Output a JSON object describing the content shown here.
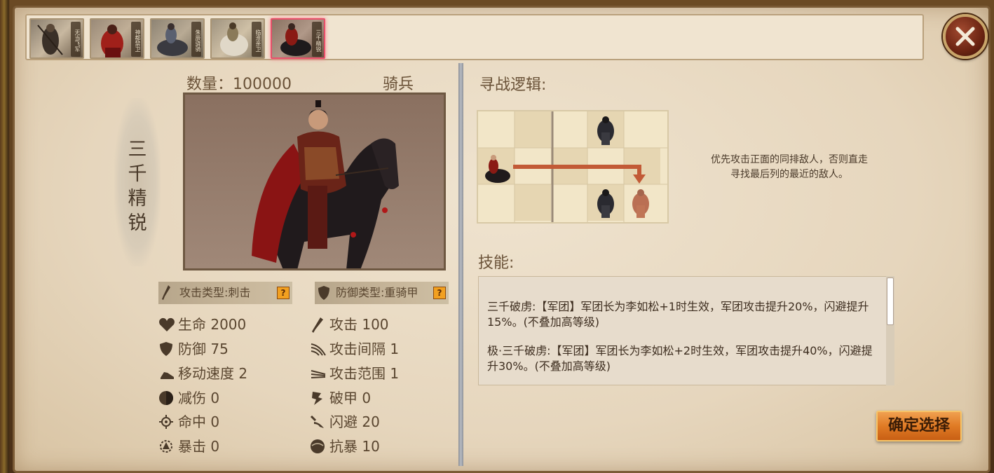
{
  "tabs": [
    {
      "label": "无当飞军",
      "active": false
    },
    {
      "label": "神都禁卫",
      "active": false
    },
    {
      "label": "朱辰骁骑",
      "active": false
    },
    {
      "label": "临淮亲卫",
      "active": false
    },
    {
      "label": "三千精锐",
      "active": true
    }
  ],
  "unit": {
    "name": "三千精锐",
    "count_label": "数量：100000",
    "type": "骑兵",
    "attack_type": "攻击类型:刺击",
    "defense_type": "防御类型:重骑甲",
    "help_glyph": "?"
  },
  "stats_left": [
    {
      "label": "生命 2000",
      "icon": "heart-icon"
    },
    {
      "label": "防御 75",
      "icon": "shield-icon"
    },
    {
      "label": "移动速度 2",
      "icon": "boot-icon"
    },
    {
      "label": "减伤 0",
      "icon": "damage-reduction-icon"
    },
    {
      "label": "命中 0",
      "icon": "target-icon"
    },
    {
      "label": "暴击 0",
      "icon": "critical-icon"
    }
  ],
  "stats_right": [
    {
      "label": "攻击 100",
      "icon": "sword-icon"
    },
    {
      "label": "攻击间隔 1",
      "icon": "attack-interval-icon"
    },
    {
      "label": "攻击范围 1",
      "icon": "attack-range-icon"
    },
    {
      "label": "破甲 0",
      "icon": "armor-break-icon"
    },
    {
      "label": "闪避 20",
      "icon": "dodge-icon"
    },
    {
      "label": "抗暴 10",
      "icon": "anti-critical-icon"
    }
  ],
  "logic": {
    "title": "寻战逻辑:",
    "description_line1": "优先攻击正面的同排敌人，否则直走",
    "description_line2": "寻找最后列的最近的敌人。"
  },
  "skills": {
    "title": "技能:",
    "entries": [
      "三千破虏:【军团】军团长为李如松+1时生效，军团攻击提升20%，闪避提升15%。(不叠加高等级)",
      "极·三千破虏:【军团】军团长为李如松+2时生效，军团攻击提升40%，闪避提升30%。(不叠加高等级)"
    ]
  },
  "confirm_label": "确定选择",
  "colors": {
    "accent": "#e07b25",
    "arrow": "#c25a36",
    "active_tab": "#e8506a"
  }
}
